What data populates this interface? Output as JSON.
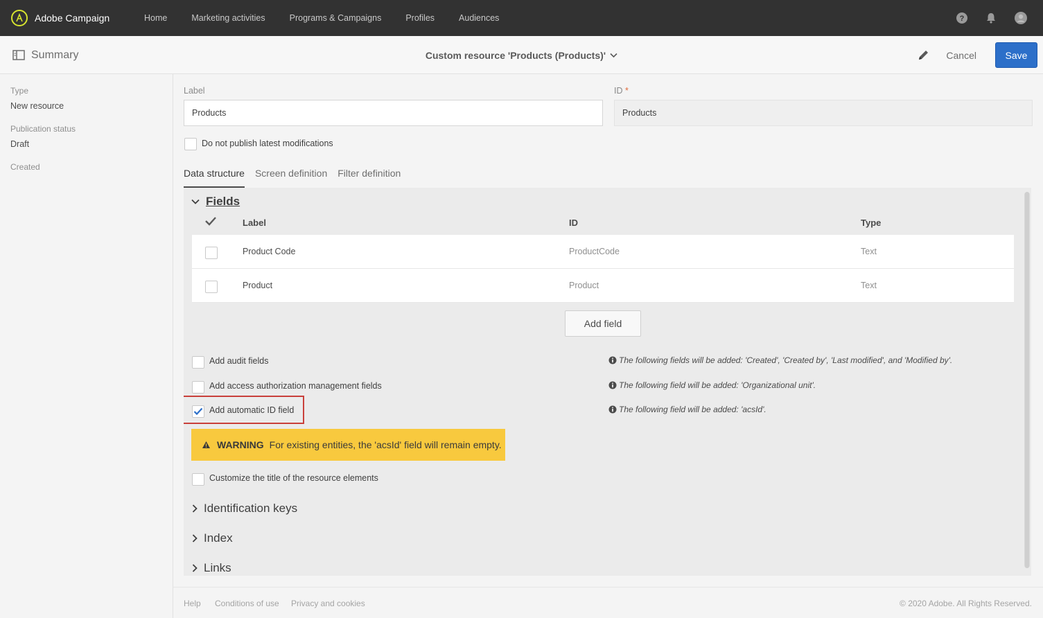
{
  "app": {
    "name": "Adobe Campaign"
  },
  "nav": {
    "items": [
      "Home",
      "Marketing activities",
      "Programs & Campaigns",
      "Profiles",
      "Audiences"
    ]
  },
  "header": {
    "summary_label": "Summary",
    "resource_title": "Custom resource 'Products (Products)'",
    "cancel_label": "Cancel",
    "save_label": "Save"
  },
  "sidebar": {
    "type_label": "Type",
    "type_value": "New resource",
    "status_label": "Publication status",
    "status_value": "Draft",
    "created_label": "Created"
  },
  "form": {
    "label_label": "Label",
    "label_value": "Products",
    "id_label": "ID",
    "id_required": "*",
    "id_value": "Products",
    "publish_checkbox_label": "Do not publish latest modifications"
  },
  "tabs": [
    "Data structure",
    "Screen definition",
    "Filter definition"
  ],
  "fields_section": {
    "title": "Fields",
    "columns": {
      "label": "Label",
      "id": "ID",
      "type": "Type"
    },
    "rows": [
      {
        "label": "Product Code",
        "id": "ProductCode",
        "type": "Text"
      },
      {
        "label": "Product",
        "id": "Product",
        "type": "Text"
      }
    ],
    "add_field_label": "Add field"
  },
  "options": {
    "audit_label": "Add audit fields",
    "audit_info": "The following fields will be added: 'Created', 'Created by', 'Last modified', and 'Modified by'.",
    "access_label": "Add access authorization management fields",
    "access_info": "The following field will be added: 'Organizational unit'.",
    "autoid_label": "Add automatic ID field",
    "autoid_info": "The following field will be added: 'acsId'.",
    "customize_label": "Customize the title of the resource elements"
  },
  "warning": {
    "tag": "WARNING",
    "message": "For existing entities, the 'acsId' field will remain empty.",
    "color": "#f8c93e"
  },
  "sections": [
    "Identification keys",
    "Index",
    "Links"
  ],
  "footer": {
    "links": [
      "Help",
      "Conditions of use",
      "Privacy and cookies"
    ],
    "copyright": "© 2020 Adobe. All Rights Reserved."
  },
  "colors": {
    "topbar": "#323232",
    "accent": "#2c6fc9",
    "highlight": "#c9403b"
  },
  "icons": [
    "adobe-campaign-logo-icon",
    "help-icon",
    "bell-icon",
    "user-avatar-icon",
    "summary-panel-icon",
    "chevron-down-icon",
    "pencil-icon",
    "checkmark-icon",
    "chevron-right-icon",
    "info-icon",
    "warning-triangle-icon"
  ]
}
